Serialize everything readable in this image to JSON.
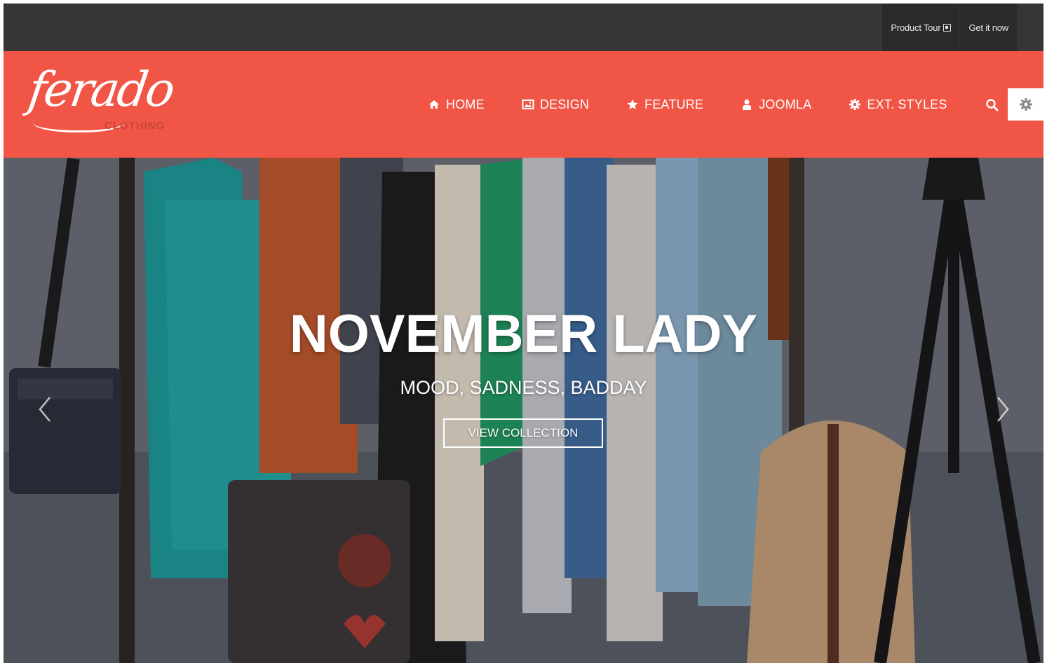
{
  "topbar": {
    "links": [
      {
        "label": "Product Tour",
        "icon": "external-link-icon"
      },
      {
        "label": "Get it now"
      }
    ]
  },
  "logo": {
    "script": "ferado",
    "sub": "CLOTHING"
  },
  "nav": {
    "items": [
      {
        "label": "HOME",
        "icon": "home-icon"
      },
      {
        "label": "DESIGN",
        "icon": "image-icon"
      },
      {
        "label": "FEATURE",
        "icon": "star-icon"
      },
      {
        "label": "JOOMLA",
        "icon": "user-icon"
      },
      {
        "label": "EXT. STYLES",
        "icon": "cog-icon"
      }
    ],
    "search_icon": "search-icon",
    "settings_icon": "gear-icon"
  },
  "hero": {
    "title": "NOVEMBER LADY",
    "subtitle": "MOOD, SADNESS, BADDAY",
    "button": "VIEW COLLECTION",
    "prev_icon": "chevron-left-icon",
    "next_icon": "chevron-right-icon"
  },
  "colors": {
    "accent": "#f15545",
    "topbar": "#363636",
    "logo_sub": "#c8473a"
  }
}
